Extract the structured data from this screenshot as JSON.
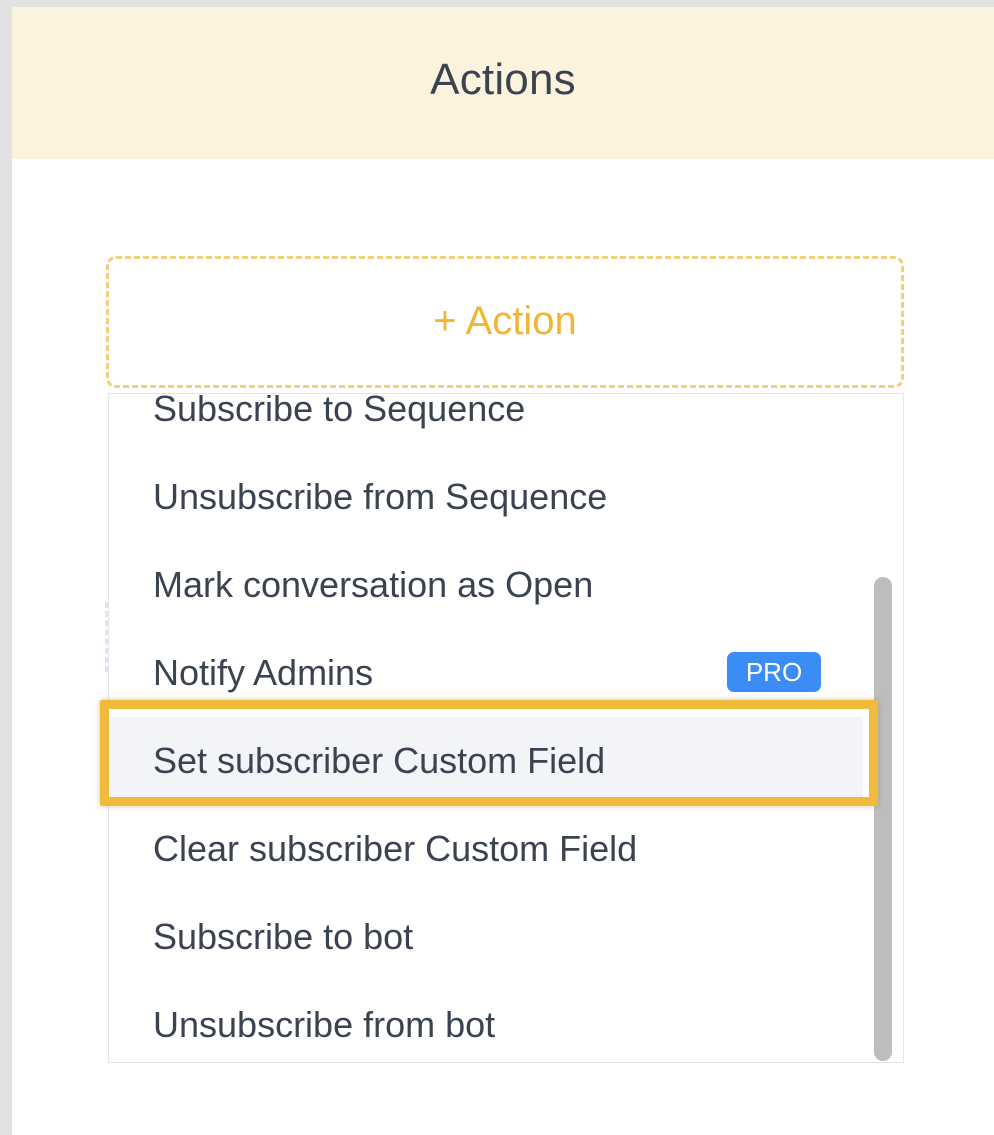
{
  "header": {
    "title": "Actions"
  },
  "add_action": {
    "label": "+ Action"
  },
  "menu": {
    "items": [
      {
        "label": "Subscribe to Sequence",
        "badge": ""
      },
      {
        "label": "Unsubscribe from Sequence",
        "badge": ""
      },
      {
        "label": "Mark conversation as Open",
        "badge": ""
      },
      {
        "label": "Notify Admins",
        "badge": "PRO"
      },
      {
        "label": "Set subscriber Custom Field",
        "badge": "",
        "highlighted": true
      },
      {
        "label": "Clear subscriber Custom Field",
        "badge": ""
      },
      {
        "label": "Subscribe to bot",
        "badge": ""
      },
      {
        "label": "Unsubscribe from bot",
        "badge": ""
      }
    ]
  },
  "colors": {
    "header_bg": "#fcf3de",
    "accent": "#f2b634",
    "highlight_border": "#f0ba3c",
    "pro_badge": "#3b8df5",
    "text": "#3b4350"
  }
}
